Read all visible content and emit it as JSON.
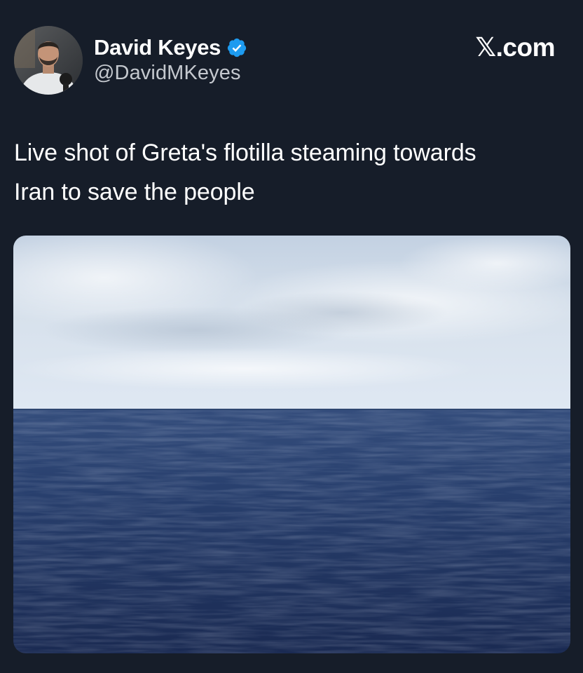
{
  "author": {
    "display_name": "David Keyes",
    "handle": "@DavidMKeyes",
    "verified": true,
    "avatar_icon": "profile-photo",
    "badge_icon": "verified-badge-icon"
  },
  "source": {
    "logo_glyph": "𝕏",
    "domain_text": ".com"
  },
  "tweet": {
    "text_lines": [
      "Live shot of Greta's flotilla steaming towards",
      "Iran to save the people"
    ]
  },
  "media": {
    "description_icon": "ocean-photo",
    "colors": {
      "sky_top": "#c9d6e4",
      "sky_bottom": "#dfe8f2",
      "sea_top": "#2c4474",
      "sea_bottom": "#1b2c55"
    }
  },
  "colors": {
    "background": "#161d29",
    "text": "#ffffff",
    "secondary_text": "#c4c8ce",
    "verified_blue": "#1d9bf0"
  }
}
